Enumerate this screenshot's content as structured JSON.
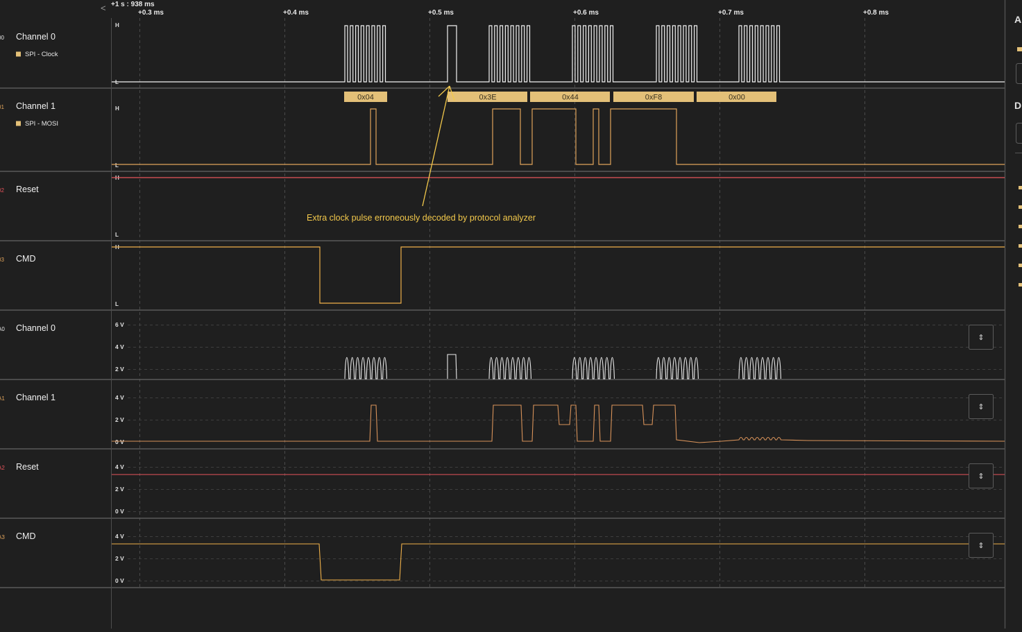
{
  "timeline": {
    "origin": "+1 s : 938 ms",
    "back_glyph": "<",
    "ticks": [
      "+0.3 ms",
      "+0.4 ms",
      "+0.5 ms",
      "+0.6 ms",
      "+0.7 ms",
      "+0.8 ms"
    ]
  },
  "channels": [
    {
      "id": "00",
      "title": "Channel 0",
      "subtitle": "SPI - Clock",
      "id_color": "#e6e6e6"
    },
    {
      "id": "01",
      "title": "Channel 1",
      "subtitle": "SPI - MOSI",
      "id_color": "#e0a35a"
    },
    {
      "id": "02",
      "title": "Reset",
      "subtitle": "",
      "id_color": "#e8535b"
    },
    {
      "id": "03",
      "title": "CMD",
      "subtitle": "",
      "id_color": "#e0a35a"
    },
    {
      "id": "A0",
      "title": "Channel 0",
      "subtitle": "",
      "id_color": "#e6e6e6"
    },
    {
      "id": "A1",
      "title": "Channel 1",
      "subtitle": "",
      "id_color": "#e0a35a"
    },
    {
      "id": "A2",
      "title": "Reset",
      "subtitle": "",
      "id_color": "#e8535b"
    },
    {
      "id": "A3",
      "title": "CMD",
      "subtitle": "",
      "id_color": "#e0a35a"
    }
  ],
  "digital_levels": {
    "high": "H",
    "low": "L"
  },
  "analog_ticks": {
    "A0": [
      "6 V",
      "4 V",
      "2 V"
    ],
    "A1": [
      "4 V",
      "2 V",
      "0 V"
    ],
    "A2": [
      "4 V",
      "2 V",
      "0 V"
    ],
    "A3": [
      "4 V",
      "2 V",
      "0 V"
    ]
  },
  "decoded_packets": [
    "0x04",
    "0x3E",
    "0x44",
    "0xF8",
    "0x00"
  ],
  "annotation": "Extra clock pulse erroneously decoded by protocol analyzer",
  "fit_button_glyph": "⇕",
  "sidebar": {
    "header_1": "A",
    "header_2": "D"
  },
  "colors": {
    "background": "#1f1f1f",
    "clock": "#f2f2f2",
    "mosi": "#e0a35a",
    "reset": "#e8535b",
    "cmd": "#f0b14a",
    "packet": "#e3c078",
    "annotation": "#f2c84b"
  }
}
